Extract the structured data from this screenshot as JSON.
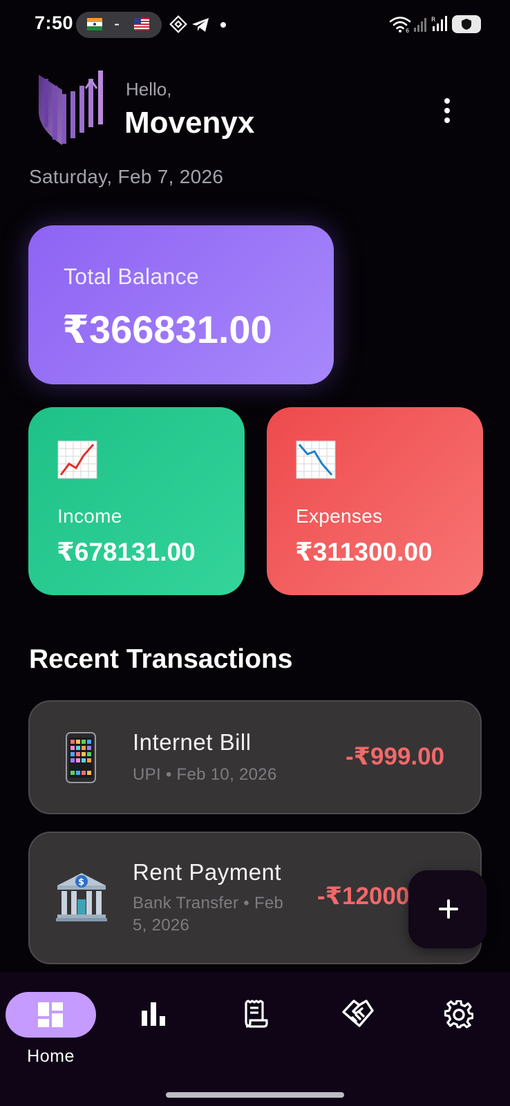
{
  "status_bar": {
    "time": "7:50",
    "flag_separator": "-",
    "icons": [
      "india-flag-icon",
      "us-flag-icon",
      "binance-icon",
      "telegram-icon",
      "notification-dot-icon",
      "wifi-icon",
      "signal-icon",
      "signal-icon",
      "battery-shield-icon"
    ]
  },
  "header": {
    "greeting": "Hello,",
    "username": "Movenyx",
    "date": "Saturday, Feb 7, 2026",
    "menu_icon": "more-vertical-icon"
  },
  "balance": {
    "label": "Total Balance",
    "amount": "₹366831.00"
  },
  "income": {
    "label": "Income",
    "amount": "₹678131.00",
    "icon": "chart-increasing-icon"
  },
  "expenses": {
    "label": "Expenses",
    "amount": "₹311300.00",
    "icon": "chart-decreasing-icon"
  },
  "recent": {
    "title": "Recent Transactions",
    "transactions": [
      {
        "title": "Internet Bill",
        "subtitle": "UPI • Feb 10, 2026",
        "amount": "-₹999.00",
        "icon": "mobile-phone-icon"
      },
      {
        "title": "Rent Payment",
        "subtitle_line1": "Bank Transfer • Feb",
        "subtitle_line2": "5, 2026",
        "amount": "-₹12000",
        "icon": "bank-icon"
      }
    ]
  },
  "fab": {
    "icon": "plus-icon"
  },
  "nav": {
    "items": [
      {
        "label": "Home",
        "icon": "dashboard-icon",
        "active": true
      },
      {
        "icon": "bar-chart-icon"
      },
      {
        "icon": "receipt-icon"
      },
      {
        "icon": "handshake-icon"
      },
      {
        "icon": "gear-icon"
      }
    ]
  },
  "colors": {
    "background": "#050307",
    "balance_card": "#9b73f7",
    "income_card": "#29c98f",
    "expense_card": "#f25c5d",
    "expense_text": "#f26969",
    "nav_active": "#c59bff",
    "card_surface": "#373436"
  }
}
